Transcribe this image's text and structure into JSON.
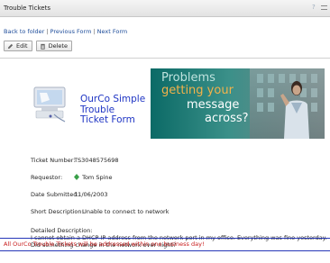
{
  "window": {
    "title": "Trouble Tickets",
    "help_glyph": "?"
  },
  "nav": {
    "back": "Back to folder",
    "previous": "Previous Form",
    "next": "Next Form",
    "separator": "|"
  },
  "toolbar": {
    "edit_label": "Edit",
    "delete_label": "Delete"
  },
  "banner": {
    "app_name_line1": "OurCo Simple",
    "app_name_line2": "Trouble",
    "app_name_line3": "Ticket Form",
    "promo_line1": "Problems",
    "promo_line2": "getting your",
    "promo_line3": "message",
    "promo_line4": "across?"
  },
  "ticket": {
    "number_label": "Ticket Number:",
    "number_value": "TS3048575698",
    "requestor_label": "Requestor:",
    "requestor_value": "Tom Spine",
    "date_label": "Date Submitted:",
    "date_value": "11/06/2003",
    "short_label": "Short Description:",
    "short_value": "Unable to connect to network",
    "detailed_label": "Detailed Description:",
    "detailed_value": "I cannot obtain a DHCP IP address from the network port in my office. Everything was fine yesterday. Did something change in the network over night?"
  },
  "footer": {
    "note": "All OurCo Trouble Tickets will be addressed within one business day!"
  },
  "colors": {
    "link": "#1d4c9a",
    "app_name": "#1f35c4",
    "footer_note": "#c81b1b",
    "footer_line": "#2637b8",
    "accent": "#f19a1c"
  }
}
